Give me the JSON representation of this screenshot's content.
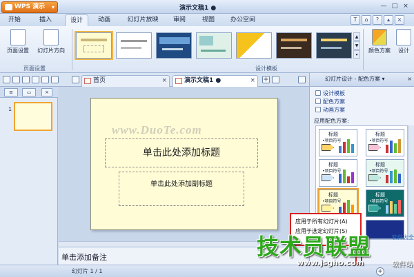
{
  "app": {
    "button_label": "WPS 演示",
    "title": "演示文稿1 ●"
  },
  "window_controls": [
    "—",
    "□",
    "×"
  ],
  "menu": {
    "tabs": [
      "开始",
      "插入",
      "设计",
      "动画",
      "幻灯片放映",
      "审阅",
      "视图",
      "办公空间"
    ],
    "active": "设计"
  },
  "ribbon": {
    "page_setup": "页面设置",
    "slide_orientation": "幻灯片方向",
    "group_page": "页面设置",
    "group_templates": "设计模板",
    "color_scheme": "颜色方案",
    "design_more": "设计"
  },
  "doc_tabs": [
    {
      "label": "首页",
      "active": false
    },
    {
      "label": "演示文稿1 ●",
      "active": true
    }
  ],
  "doc_tab_plus": "+",
  "left_panel": {
    "slide_number": "1"
  },
  "slide": {
    "title_placeholder": "单击此处添加标题",
    "subtitle_placeholder": "单击此处添加副标题",
    "watermark": "www.DuoTe.com"
  },
  "notes_placeholder": "单击添加备注",
  "right_panel": {
    "header": "幻灯片设计 - 配色方案 ▾",
    "links": [
      "设计模板",
      "配色方案",
      "动画方案"
    ],
    "section_label": "应用配色方案:",
    "scheme_title": "标题",
    "scheme_bullet": "•项目符号"
  },
  "context_menu": {
    "items": [
      "应用于所有幻灯片(A)",
      "应用于选定幻灯片(S)"
    ]
  },
  "status": {
    "slide_info": "幻灯片 1 / 1"
  },
  "branding": {
    "main": "技术员联盟",
    "url": "www.jsgho.com",
    "side": "软件大全",
    "side2": "软件站"
  },
  "colors": {
    "accent_orange": "#f0a433",
    "menu_blue": "#c9d9ee",
    "slide_bg": "#fffcd6",
    "highlight_red": "#d62020"
  }
}
